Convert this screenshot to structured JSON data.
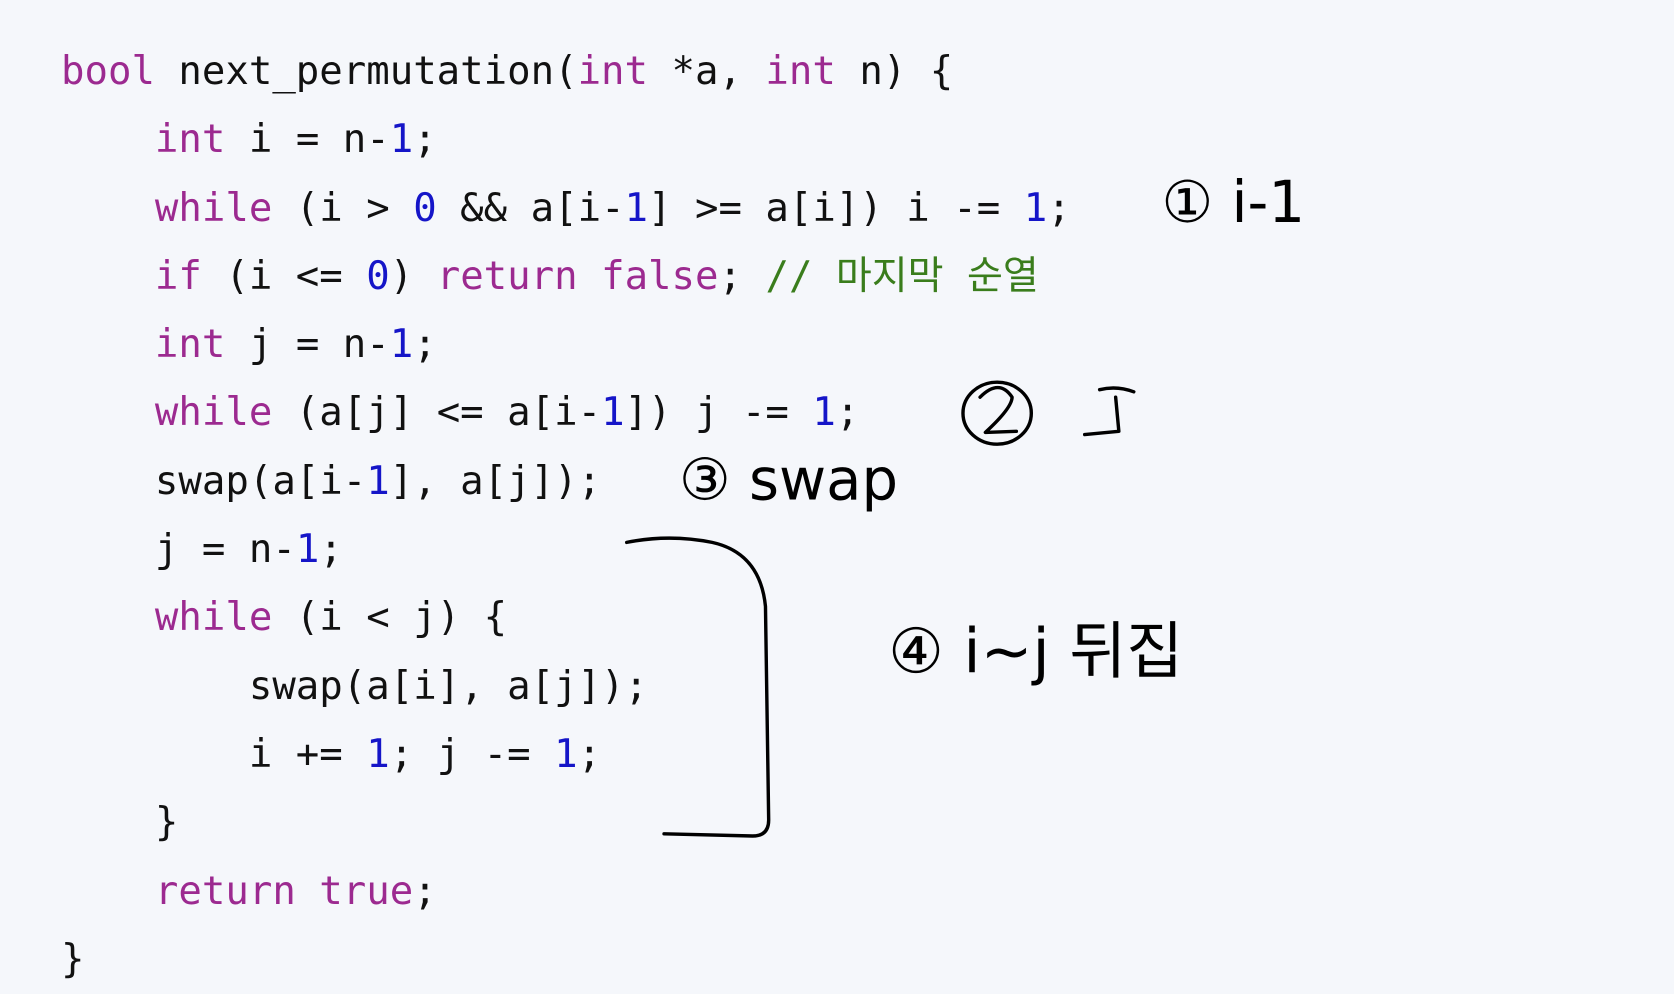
{
  "code": {
    "language": "cpp",
    "lines": [
      [
        [
          "kw",
          "bool"
        ],
        [
          "tx",
          " next_permutation("
        ],
        [
          "kw",
          "int"
        ],
        [
          "tx",
          " *a, "
        ],
        [
          "kw",
          "int"
        ],
        [
          "tx",
          " n) {"
        ]
      ],
      [
        [
          "tx",
          "    "
        ],
        [
          "kw",
          "int"
        ],
        [
          "tx",
          " i = n-"
        ],
        [
          "num",
          "1"
        ],
        [
          "tx",
          ";"
        ]
      ],
      [
        [
          "tx",
          "    "
        ],
        [
          "kw",
          "while"
        ],
        [
          "tx",
          " (i > "
        ],
        [
          "num",
          "0"
        ],
        [
          "tx",
          " && a[i-"
        ],
        [
          "num",
          "1"
        ],
        [
          "tx",
          "] >= a[i]) i -= "
        ],
        [
          "num",
          "1"
        ],
        [
          "tx",
          ";"
        ]
      ],
      [
        [
          "tx",
          "    "
        ],
        [
          "kw",
          "if"
        ],
        [
          "tx",
          " (i <= "
        ],
        [
          "num",
          "0"
        ],
        [
          "tx",
          ") "
        ],
        [
          "kw",
          "return"
        ],
        [
          "tx",
          " "
        ],
        [
          "kw",
          "false"
        ],
        [
          "tx",
          "; "
        ],
        [
          "cm",
          "// 마지막 순열"
        ]
      ],
      [
        [
          "tx",
          "    "
        ],
        [
          "kw",
          "int"
        ],
        [
          "tx",
          " j = n-"
        ],
        [
          "num",
          "1"
        ],
        [
          "tx",
          ";"
        ]
      ],
      [
        [
          "tx",
          "    "
        ],
        [
          "kw",
          "while"
        ],
        [
          "tx",
          " (a[j] <= a[i-"
        ],
        [
          "num",
          "1"
        ],
        [
          "tx",
          "]) j -= "
        ],
        [
          "num",
          "1"
        ],
        [
          "tx",
          ";"
        ]
      ],
      [
        [
          "tx",
          "    swap(a[i-"
        ],
        [
          "num",
          "1"
        ],
        [
          "tx",
          "], a[j]);"
        ]
      ],
      [
        [
          "tx",
          "    j = n-"
        ],
        [
          "num",
          "1"
        ],
        [
          "tx",
          ";"
        ]
      ],
      [
        [
          "tx",
          "    "
        ],
        [
          "kw",
          "while"
        ],
        [
          "tx",
          " (i < j) {"
        ]
      ],
      [
        [
          "tx",
          "        swap(a[i], a[j]);"
        ]
      ],
      [
        [
          "tx",
          "        i += "
        ],
        [
          "num",
          "1"
        ],
        [
          "tx",
          "; j -= "
        ],
        [
          "num",
          "1"
        ],
        [
          "tx",
          ";"
        ]
      ],
      [
        [
          "tx",
          "    }"
        ]
      ],
      [
        [
          "tx",
          "    "
        ],
        [
          "kw",
          "return"
        ],
        [
          "tx",
          " "
        ],
        [
          "kw",
          "true"
        ],
        [
          "tx",
          ";"
        ]
      ],
      [
        [
          "tx",
          "}"
        ]
      ]
    ]
  },
  "handwritten_annotations": [
    "① i-1",
    "② j",
    "③ swap",
    "④ i~j 뒤집"
  ],
  "colors": {
    "background": "#f5f7fb",
    "keyword": "#9c2a90",
    "number": "#1515c8",
    "comment": "#3a7d1c",
    "text": "#111111",
    "ink": "#000000"
  }
}
